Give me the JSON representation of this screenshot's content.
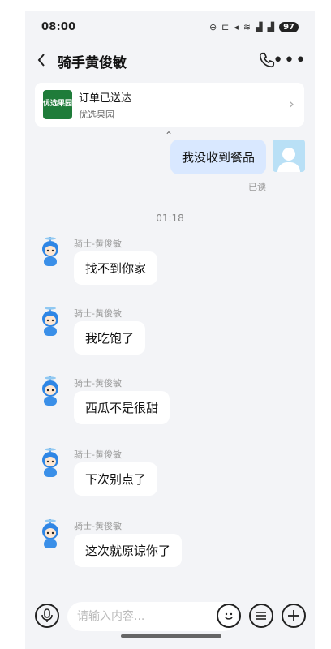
{
  "status_bar": {
    "time": "08:00",
    "icons": [
      "alarm-icon",
      "dnd-icon",
      "bed-icon",
      "mute-icon",
      "wifi-icon",
      "signal-5g-icon",
      "signal-5g-icon"
    ],
    "battery": "97"
  },
  "header": {
    "title": "骑手黄俊敏",
    "back_icon": "chevron-left-icon",
    "call_icon": "phone-icon",
    "more_icon": "more-icon"
  },
  "order_card": {
    "status": "订单已送达",
    "store": "优选果园",
    "logo_text": "优选果园"
  },
  "sent_message": {
    "text": "我没收到餐品",
    "read_label": "已读"
  },
  "timestamp": "01:18",
  "incoming": [
    {
      "sender": "骑士-黄俊敏",
      "text": "找不到你家"
    },
    {
      "sender": "骑士-黄俊敏",
      "text": "我吃饱了"
    },
    {
      "sender": "骑士-黄俊敏",
      "text": "西瓜不是很甜"
    },
    {
      "sender": "骑士-黄俊敏",
      "text": "下次别点了"
    },
    {
      "sender": "骑士-黄俊敏",
      "text": "这次就原谅你了"
    }
  ],
  "input_bar": {
    "placeholder": "请输入内容..."
  },
  "colors": {
    "background": "#f3f4f7",
    "sent_bubble": "#d9e8ff",
    "incoming_bubble": "#ffffff",
    "store_logo": "#1f7c3a"
  }
}
